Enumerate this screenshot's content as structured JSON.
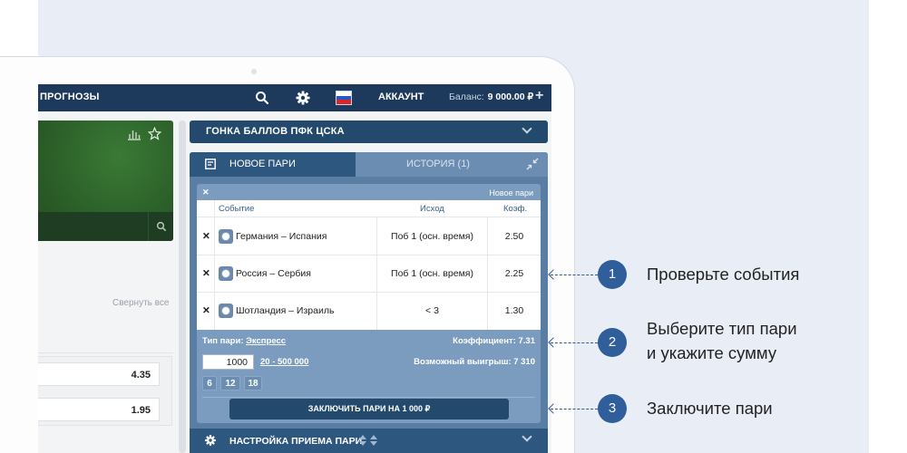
{
  "topbar": {
    "nav_label": "ПРОГНОЗЫ",
    "account_label": "АККАУНТ",
    "balance_label": "Баланс:",
    "balance_value": "9 000.00 ₽",
    "icons": [
      "search-icon",
      "gear-icon",
      "flag-russia-icon",
      "plus-icon"
    ]
  },
  "left": {
    "collapse_all": "Свернуть все",
    "odds": [
      "4.35",
      "1.95"
    ]
  },
  "panel": {
    "title": "ГОНКА БАЛЛОВ ПФК ЦСКА"
  },
  "betslip": {
    "tab_new": "НОВОЕ ПАРИ",
    "tab_history": "ИСТОРИЯ (1)",
    "card_title": "Новое пари",
    "columns": {
      "event": "Событие",
      "outcome": "Исход",
      "odds": "Коэф."
    },
    "rows": [
      {
        "event": "Германия – Испания",
        "outcome": "Поб 1 (осн. время)",
        "odds": "2.50"
      },
      {
        "event": "Россия – Сербия",
        "outcome": "Поб 1 (осн. время)",
        "odds": "2.25"
      },
      {
        "event": "Шотландия – Израиль",
        "outcome": "< 3",
        "odds": "1.30"
      }
    ],
    "bet_type_label": "Тип пари:",
    "bet_type_value": "Экспресс",
    "coef_label": "Коэффициент: 7.31",
    "amount": "1000",
    "range_link": "20 - 500 000",
    "possible_win": "Возможный выигрыш: 7 310",
    "quick_chips": [
      "6",
      "12",
      "18"
    ],
    "place_button": "ЗАКЛЮЧИТЬ ПАРИ НА 1 000 ₽",
    "settings_label": "НАСТРОЙКА ПРИЕМА ПАРИ"
  },
  "callouts": [
    {
      "num": "1",
      "line1": "Проверьте события",
      "line2": ""
    },
    {
      "num": "2",
      "line1": "Выберите тип пари",
      "line2": "и укажите сумму"
    },
    {
      "num": "3",
      "line1": "Заключите пари",
      "line2": ""
    }
  ],
  "colors": {
    "navy": "#1d3a5c",
    "slip": "#5a7ea3",
    "accent_blue": "#2f5e9a",
    "page_bg": "#e9eef6"
  }
}
